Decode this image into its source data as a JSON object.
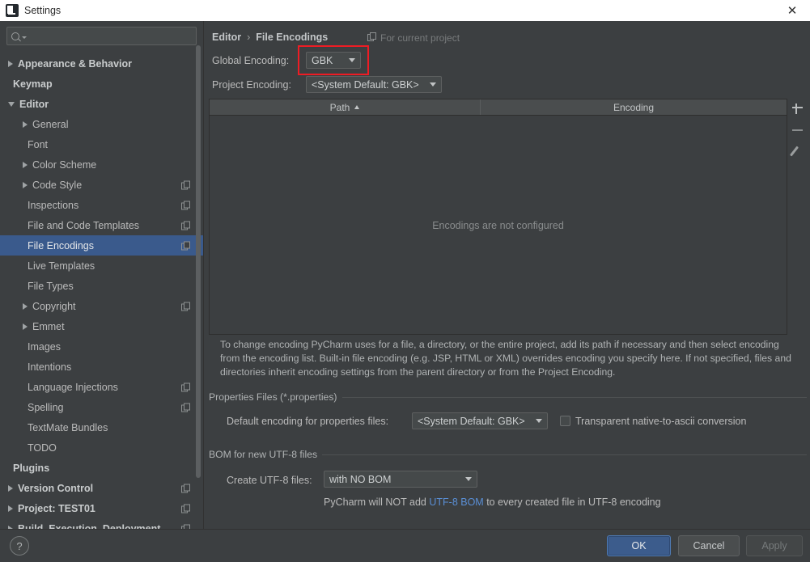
{
  "window": {
    "title": "Settings",
    "logo_icon": "pycharm-logo-icon",
    "close_icon": "close-icon"
  },
  "sidebar": {
    "search": {
      "placeholder": "",
      "value": "",
      "icon": "search-icon",
      "caret_icon": "chevron-down-icon"
    },
    "items": [
      {
        "label": "Appearance & Behavior",
        "arrow": "collapsed",
        "indent": 0,
        "bold": true,
        "copy": false,
        "selected": false
      },
      {
        "label": "Keymap",
        "arrow": "none",
        "indent": 0,
        "bold": true,
        "copy": false,
        "selected": false
      },
      {
        "label": "Editor",
        "arrow": "expanded",
        "indent": 0,
        "bold": true,
        "copy": false,
        "selected": false
      },
      {
        "label": "General",
        "arrow": "collapsed",
        "indent": 1,
        "bold": false,
        "copy": false,
        "selected": false
      },
      {
        "label": "Font",
        "arrow": "none",
        "indent": 1,
        "bold": false,
        "copy": false,
        "selected": false
      },
      {
        "label": "Color Scheme",
        "arrow": "collapsed",
        "indent": 1,
        "bold": false,
        "copy": false,
        "selected": false
      },
      {
        "label": "Code Style",
        "arrow": "collapsed",
        "indent": 1,
        "bold": false,
        "copy": true,
        "selected": false
      },
      {
        "label": "Inspections",
        "arrow": "none",
        "indent": 1,
        "bold": false,
        "copy": true,
        "selected": false
      },
      {
        "label": "File and Code Templates",
        "arrow": "none",
        "indent": 1,
        "bold": false,
        "copy": true,
        "selected": false
      },
      {
        "label": "File Encodings",
        "arrow": "none",
        "indent": 1,
        "bold": false,
        "copy": true,
        "selected": true
      },
      {
        "label": "Live Templates",
        "arrow": "none",
        "indent": 1,
        "bold": false,
        "copy": false,
        "selected": false
      },
      {
        "label": "File Types",
        "arrow": "none",
        "indent": 1,
        "bold": false,
        "copy": false,
        "selected": false
      },
      {
        "label": "Copyright",
        "arrow": "collapsed",
        "indent": 1,
        "bold": false,
        "copy": true,
        "selected": false
      },
      {
        "label": "Emmet",
        "arrow": "collapsed",
        "indent": 1,
        "bold": false,
        "copy": false,
        "selected": false
      },
      {
        "label": "Images",
        "arrow": "none",
        "indent": 1,
        "bold": false,
        "copy": false,
        "selected": false
      },
      {
        "label": "Intentions",
        "arrow": "none",
        "indent": 1,
        "bold": false,
        "copy": false,
        "selected": false
      },
      {
        "label": "Language Injections",
        "arrow": "none",
        "indent": 1,
        "bold": false,
        "copy": true,
        "selected": false
      },
      {
        "label": "Spelling",
        "arrow": "none",
        "indent": 1,
        "bold": false,
        "copy": true,
        "selected": false
      },
      {
        "label": "TextMate Bundles",
        "arrow": "none",
        "indent": 1,
        "bold": false,
        "copy": false,
        "selected": false
      },
      {
        "label": "TODO",
        "arrow": "none",
        "indent": 1,
        "bold": false,
        "copy": false,
        "selected": false
      },
      {
        "label": "Plugins",
        "arrow": "none",
        "indent": 0,
        "bold": true,
        "copy": false,
        "selected": false
      },
      {
        "label": "Version Control",
        "arrow": "collapsed",
        "indent": 0,
        "bold": true,
        "copy": true,
        "selected": false
      },
      {
        "label": "Project: TEST01",
        "arrow": "collapsed",
        "indent": 0,
        "bold": true,
        "copy": true,
        "selected": false
      },
      {
        "label": "Build, Execution, Deployment",
        "arrow": "collapsed",
        "indent": 0,
        "bold": true,
        "copy": true,
        "selected": false
      }
    ]
  },
  "content": {
    "breadcrumb": {
      "parent": "Editor",
      "separator": "›",
      "current": "File Encodings"
    },
    "scope_note": {
      "icon": "project-scope-icon",
      "text": "For current project"
    },
    "global_encoding": {
      "label": "Global Encoding:",
      "value": "GBK",
      "caret_icon": "chevron-down-icon"
    },
    "project_encoding": {
      "label": "Project Encoding:",
      "value": "<System Default: GBK>",
      "caret_icon": "chevron-down-icon"
    },
    "table": {
      "columns": [
        "Path",
        "Encoding"
      ],
      "sort_column": "Path",
      "sort_direction": "ascending",
      "rows": [],
      "empty_text": "Encodings are not configured",
      "toolbar": [
        {
          "icon": "plus-icon",
          "name": "add-encoding-button",
          "enabled": true
        },
        {
          "icon": "minus-icon",
          "name": "remove-encoding-button",
          "enabled": false
        },
        {
          "icon": "pencil-icon",
          "name": "edit-encoding-button",
          "enabled": false
        }
      ]
    },
    "description": "To change encoding PyCharm uses for a file, a directory, or the entire project, add its path if necessary and then select encoding from the encoding list. Built-in file encoding (e.g. JSP, HTML or XML) overrides encoding you specify here. If not specified, files and directories inherit encoding settings from the parent directory or from the Project Encoding.",
    "properties_section": {
      "title": "Properties Files (*.properties)",
      "default_encoding_label": "Default encoding for properties files:",
      "default_encoding_value": "<System Default: GBK>",
      "transparent_checkbox_label": "Transparent native-to-ascii conversion",
      "transparent_checked": false
    },
    "bom_section": {
      "title": "BOM for new UTF-8 files",
      "create_label": "Create UTF-8 files:",
      "create_value": "with NO BOM",
      "note_prefix": "PyCharm will NOT add ",
      "note_link": "UTF-8 BOM",
      "note_suffix": " to every created file in UTF-8 encoding"
    },
    "annotation": {
      "shape": "rectangle",
      "color": "#ee1c24",
      "target": "global-encoding-dropdown"
    }
  },
  "footer": {
    "help_label": "?",
    "ok_label": "OK",
    "cancel_label": "Cancel",
    "apply_label": "Apply",
    "apply_enabled": false
  }
}
